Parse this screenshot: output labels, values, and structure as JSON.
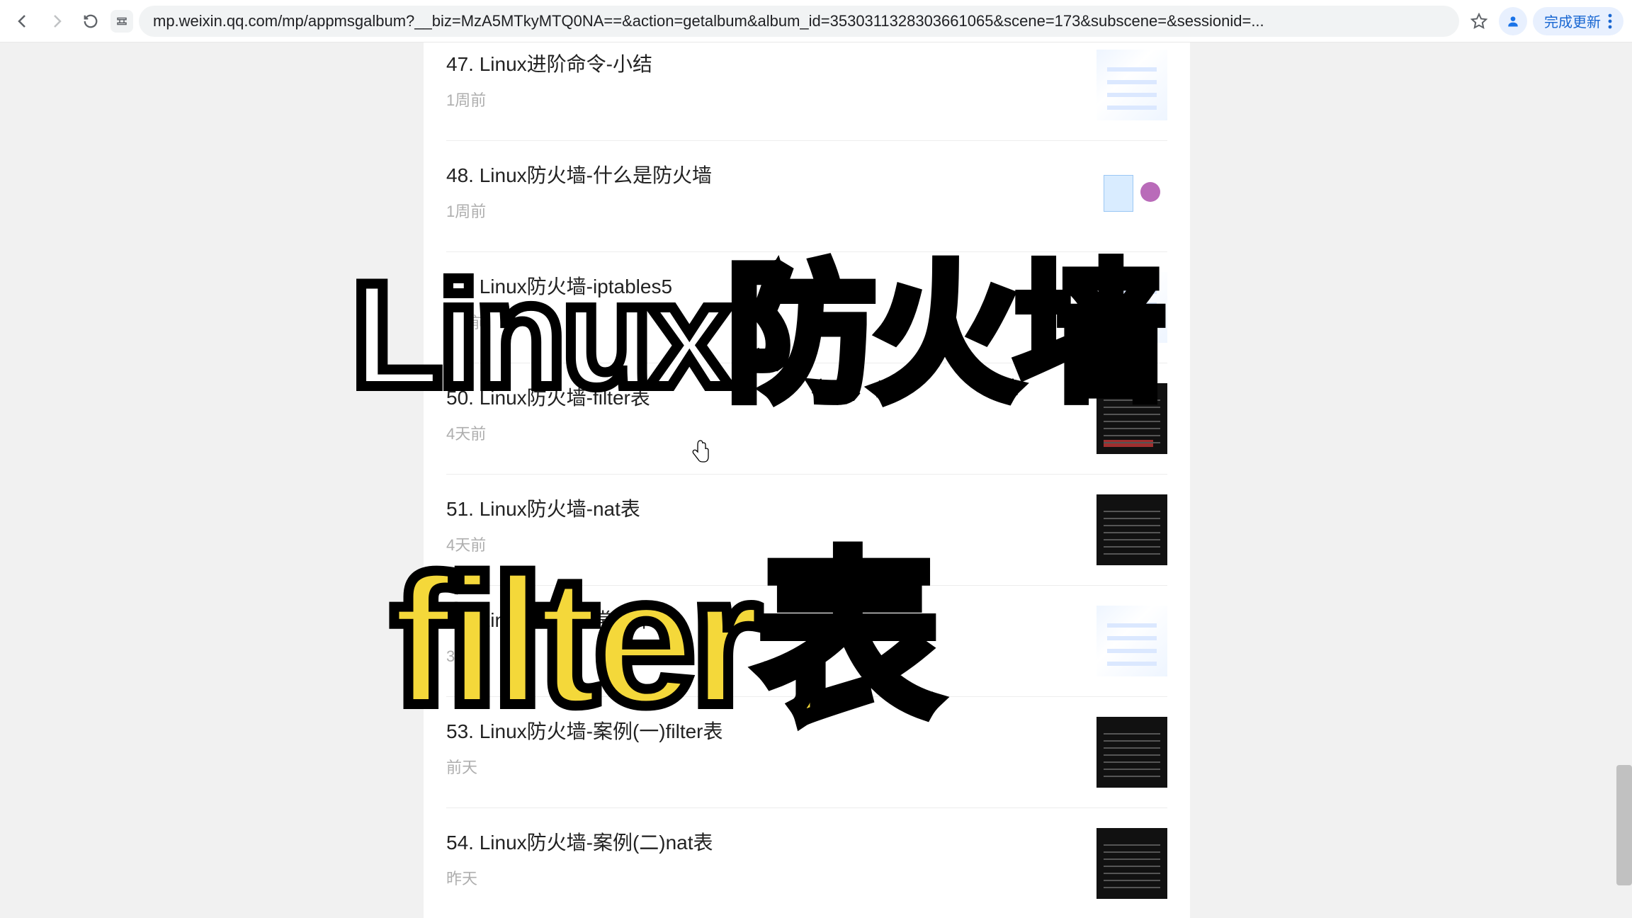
{
  "url": "mp.weixin.qq.com/mp/appmsgalbum?__biz=MzA5MTkyMTQ0NA==&action=getalbum&album_id=3530311328303661065&scene=173&subscene=&sessionid=...",
  "update_button": "完成更新",
  "overlay": {
    "line1": "Linux防火墙",
    "line2": "filter表"
  },
  "articles": [
    {
      "title": "47. Linux进阶命令-小结",
      "meta": "1周前",
      "thumb": "diagram"
    },
    {
      "title": "48. Linux防火墙-什么是防火墙",
      "meta": "1周前",
      "thumb": "net"
    },
    {
      "title": "49. Linux防火墙-iptables5",
      "meta": "5天前",
      "thumb": "diagram"
    },
    {
      "title": "50. Linux防火墙-filter表",
      "meta": "4天前",
      "thumb": "darkred"
    },
    {
      "title": "51. Linux防火墙-nat表",
      "meta": "4天前",
      "thumb": "dark"
    },
    {
      "title": "52. Linux防火墙-常用命令",
      "meta": "3天前",
      "thumb": "diagram"
    },
    {
      "title": "53. Linux防火墙-案例(一)filter表",
      "meta": "前天",
      "thumb": "dark"
    },
    {
      "title": "54. Linux防火墙-案例(二)nat表",
      "meta": "昨天",
      "thumb": "dark"
    }
  ]
}
